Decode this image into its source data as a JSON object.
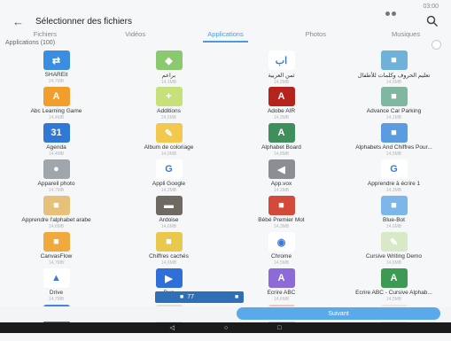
{
  "status": {
    "time": "03:00"
  },
  "header": {
    "title": "Sélectionner des fichiers"
  },
  "tabs": [
    "Fichiers",
    "Vidéos",
    "Applications",
    "Photos",
    "Musiques"
  ],
  "section": {
    "label": "Applications (100)"
  },
  "apps": [
    {
      "name": "SHAREit",
      "size": "24,7MB",
      "icon": "shareit-icon",
      "color": "#3a8de0",
      "glyph": "⇄"
    },
    {
      "name": "براعم",
      "size": "14,1MB",
      "icon": "baraem-icon",
      "color": "#8ac96d",
      "glyph": "◆"
    },
    {
      "name": "ثمن العربية",
      "size": "14,2MB",
      "icon": "arabic-letters-icon",
      "color": "#ffffff",
      "glyph": "اب"
    },
    {
      "name": "تعليم الحروف وكلمات للأطفال",
      "size": "14,6MB",
      "icon": "kids-letters-icon",
      "color": "#6fb2d9",
      "glyph": "■"
    },
    {
      "name": "Abc Learning Game",
      "size": "14,4MB",
      "icon": "abc-game-icon",
      "color": "#f29e2c",
      "glyph": "A"
    },
    {
      "name": "Additions",
      "size": "24,5MB",
      "icon": "additions-icon",
      "color": "#c7e07a",
      "glyph": "+"
    },
    {
      "name": "Adobe AIR",
      "size": "14,3MB",
      "icon": "adobe-air-icon",
      "color": "#b5231d",
      "glyph": "A"
    },
    {
      "name": "Advance Car Parking",
      "size": "14,1MB",
      "icon": "car-parking-icon",
      "color": "#7fb7a0",
      "glyph": "■"
    },
    {
      "name": "Agenda",
      "size": "14,4MB",
      "icon": "calendar-icon",
      "color": "#2f78d6",
      "glyph": "31"
    },
    {
      "name": "Album de coloriage",
      "size": "14,0MB",
      "icon": "coloring-album-icon",
      "color": "#f2c94c",
      "glyph": "✎"
    },
    {
      "name": "Alphabet Board",
      "size": "14,8MB",
      "icon": "alphabet-board-icon",
      "color": "#3e8f5b",
      "glyph": "A"
    },
    {
      "name": "Alphabets And Chiffres Pour...",
      "size": "14,5MB",
      "icon": "alphabets-numbers-icon",
      "color": "#5b9be0",
      "glyph": "■"
    },
    {
      "name": "Appareil photo",
      "size": "14,7MB",
      "icon": "camera-icon",
      "color": "#9fa7ad",
      "glyph": "●"
    },
    {
      "name": "Appli Google",
      "size": "14,2MB",
      "icon": "google-icon",
      "color": "#ffffff",
      "glyph": "G"
    },
    {
      "name": "App.vox",
      "size": "14,3MB",
      "icon": "appvox-icon",
      "color": "#8b8f94",
      "glyph": "◀"
    },
    {
      "name": "Apprendre à écrire 1",
      "size": "14,3MB",
      "icon": "learn-write-icon",
      "color": "#ffffff",
      "glyph": "G"
    },
    {
      "name": "Apprendre l'alphabet arabe",
      "size": "14,6MB",
      "icon": "arabic-alphabet-icon",
      "color": "#e7c07a",
      "glyph": "■"
    },
    {
      "name": "Ardoise",
      "size": "14,6MB",
      "icon": "slate-icon",
      "color": "#6f6a61",
      "glyph": "▬"
    },
    {
      "name": "Bébé Premier Mot",
      "size": "14,3MB",
      "icon": "baby-first-word-icon",
      "color": "#d44a3a",
      "glyph": "■"
    },
    {
      "name": "Blue-Bot",
      "size": "14,6MB",
      "icon": "bluebot-icon",
      "color": "#7db6e8",
      "glyph": "■"
    },
    {
      "name": "CanvasFlow",
      "size": "14,7MB",
      "icon": "canvasflow-icon",
      "color": "#f0a93d",
      "glyph": "■"
    },
    {
      "name": "Chiffres cachés",
      "size": "14,6MB",
      "icon": "hidden-numbers-icon",
      "color": "#e9c94b",
      "glyph": "■"
    },
    {
      "name": "Chrome",
      "size": "14,5MB",
      "icon": "chrome-icon",
      "color": "#ffffff",
      "glyph": "◉"
    },
    {
      "name": "Cursive Writing Demo",
      "size": "14,6MB",
      "icon": "cursive-icon",
      "color": "#d8e9c8",
      "glyph": "✎"
    },
    {
      "name": "Drive",
      "size": "14,7MB",
      "icon": "drive-icon",
      "color": "#ffffff",
      "glyph": "▲"
    },
    {
      "name": "Duo",
      "size": "14,5MB",
      "icon": "duo-icon",
      "color": "#2e6fd8",
      "glyph": "▶"
    },
    {
      "name": "Ecrire ABC",
      "size": "14,6MB",
      "icon": "write-abc-icon",
      "color": "#8e6ad8",
      "glyph": "A"
    },
    {
      "name": "Ecrire ABC - Cursive Alphab...",
      "size": "14,5MB",
      "icon": "write-abc-cursive-icon",
      "color": "#3d9a52",
      "glyph": "A"
    },
    {
      "name": "",
      "size": "",
      "icon": "app-icon-1",
      "color": "#3d86d8",
      "glyph": "■"
    },
    {
      "name": "",
      "size": "",
      "icon": "app-icon-2",
      "color": "#e0e0e0",
      "glyph": ""
    },
    {
      "name": "",
      "size": "",
      "icon": "app-icon-3",
      "color": "#e9c7c7",
      "glyph": "■"
    },
    {
      "name": "",
      "size": "",
      "icon": "app-icon-4",
      "color": "#e7e7e7",
      "glyph": ""
    }
  ],
  "floating_bar": {
    "left": "■",
    "count": "77",
    "right": "■"
  },
  "send_button": {
    "label": "Suivant"
  },
  "navbar": {
    "back": "◁",
    "home": "○",
    "recent": "□"
  }
}
